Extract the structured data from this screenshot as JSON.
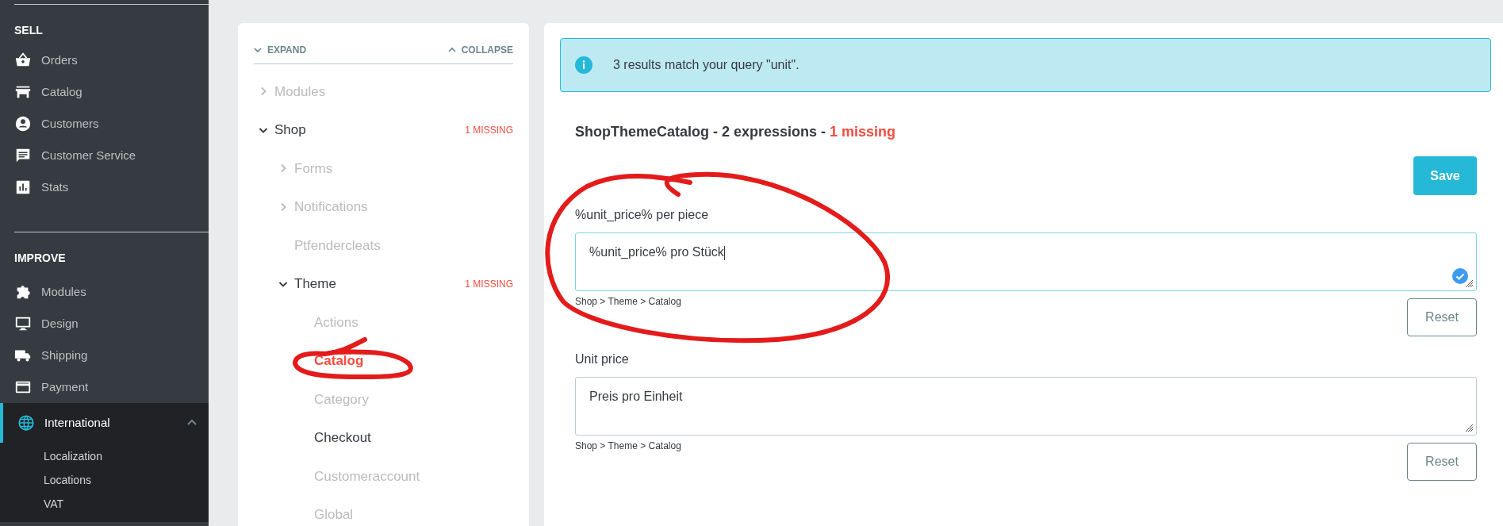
{
  "sidebar": {
    "groups": [
      {
        "title": "SELL",
        "items": [
          {
            "label": "Orders",
            "selected": false
          },
          {
            "label": "Catalog",
            "selected": false
          },
          {
            "label": "Customers",
            "selected": false
          },
          {
            "label": "Customer Service",
            "selected": false
          },
          {
            "label": "Stats",
            "selected": false
          }
        ]
      },
      {
        "title": "IMPROVE",
        "items": [
          {
            "label": "Modules",
            "selected": false
          },
          {
            "label": "Design",
            "selected": false
          },
          {
            "label": "Shipping",
            "selected": false
          },
          {
            "label": "Payment",
            "selected": false
          },
          {
            "label": "International",
            "selected": true,
            "expanded": true,
            "children": [
              {
                "label": "Localization"
              },
              {
                "label": "Locations"
              },
              {
                "label": "VAT"
              }
            ]
          }
        ]
      }
    ]
  },
  "tree": {
    "expand_label": "EXPAND",
    "collapse_label": "COLLAPSE",
    "nodes": [
      {
        "label": "Modules",
        "expanded": false,
        "dimmed": true,
        "selected": false
      },
      {
        "label": "Shop",
        "expanded": true,
        "dimmed": false,
        "selected": false,
        "badge": "1 MISSING",
        "children": [
          {
            "label": "Forms",
            "expanded": false,
            "dimmed": true,
            "selected": false
          },
          {
            "label": "Notifications",
            "expanded": false,
            "dimmed": true,
            "selected": false
          },
          {
            "label": "Ptfendercleats",
            "dimmed": true,
            "selected": false
          },
          {
            "label": "Theme",
            "expanded": true,
            "dimmed": false,
            "selected": false,
            "badge": "1 MISSING",
            "children": [
              {
                "label": "Actions",
                "dimmed": true,
                "selected": false
              },
              {
                "label": "Catalog",
                "selected": true
              },
              {
                "label": "Category",
                "dimmed": true,
                "selected": false
              },
              {
                "label": "Checkout",
                "dimmed": false,
                "selected": false
              },
              {
                "label": "Customeraccount",
                "dimmed": true,
                "selected": false
              },
              {
                "label": "Global",
                "dimmed": true,
                "selected": false
              }
            ]
          }
        ]
      }
    ]
  },
  "alert": {
    "text": "3 results match your query \"unit\"."
  },
  "domain": {
    "title": "ShopThemeCatalog - 2 expressions - ",
    "missing": "1 missing"
  },
  "save_button": "Save",
  "expressions": [
    {
      "label": "%unit_price% per piece",
      "value": "%unit_price% pro Stück",
      "focused": true,
      "validated": true,
      "path": "Shop > Theme > Catalog",
      "reset": "Reset"
    },
    {
      "label": "Unit price",
      "value": "Preis pro Einheit",
      "focused": false,
      "validated": false,
      "path": "Shop > Theme > Catalog",
      "reset": "Reset"
    }
  ]
}
